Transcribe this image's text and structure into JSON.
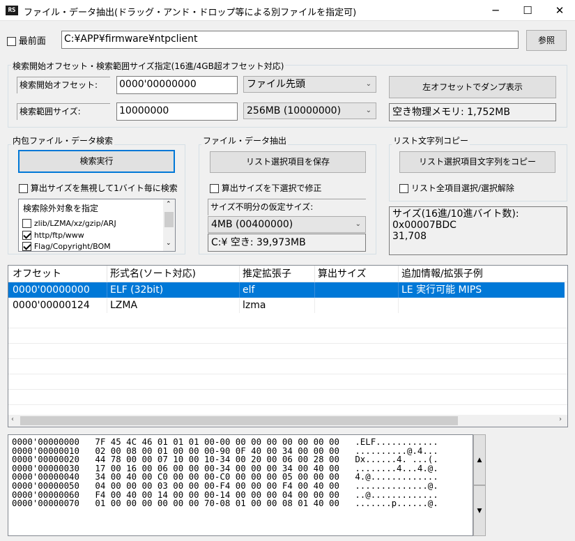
{
  "window": {
    "icon_text": "RS",
    "title": "ファイル・データ抽出(ドラッグ・アンド・ドロップ等による別ファイルを指定可)",
    "controls": [
      "─",
      "☐",
      "✕"
    ]
  },
  "topbar": {
    "topmost_label": "最前面",
    "path_value": "C:¥APP¥firmware¥ntpclient",
    "browse_label": "参照"
  },
  "search_range": {
    "group_title": "検索開始オフセット・検索範囲サイズ指定(16進/4GB超オフセット対応)",
    "start_offset_label": "検索開始オフセット:",
    "start_offset_value": "0000'00000000",
    "start_combo": "ファイル先頭",
    "range_size_label": "検索範囲サイズ:",
    "range_size_value": "10000000",
    "range_combo": "256MB (10000000)",
    "dump_button": "左オフセットでダンプ表示",
    "free_memory": "空き物理メモリ: 1,752MB"
  },
  "embedded_search": {
    "group_title": "内包ファイル・データ検索",
    "run_button": "検索実行",
    "ignore_size_label": "算出サイズを無視して1バイト毎に検索",
    "exclude_title": "検索除外対象を指定",
    "exclude_items": [
      {
        "label": "zlib/LZMA/xz/gzip/ARJ",
        "checked": false
      },
      {
        "label": "http/ftp/www",
        "checked": true
      },
      {
        "label": "Flag/Copyright/BOM",
        "checked": true
      }
    ]
  },
  "extract": {
    "group_title": "ファイル・データ抽出",
    "save_button": "リスト選択項目を保存",
    "fix_size_label": "算出サイズを下選択で修正",
    "unknown_size_label": "サイズ不明分の仮定サイズ:",
    "size_combo": "4MB   (00400000)",
    "drive_free": "C:¥  空き: 39,973MB"
  },
  "copy": {
    "group_title": "リスト文字列コピー",
    "copy_button": "リスト選択項目文字列をコピー",
    "select_all_label": "リスト全項目選択/選択解除",
    "size_info_lines": [
      "サイズ(16進/10進バイト数):",
      "0x00007BDC",
      "31,708"
    ]
  },
  "results": {
    "columns": [
      "オフセット",
      "形式名(ソート対応)",
      "推定拡張子",
      "算出サイズ",
      "追加情報/拡張子例"
    ],
    "rows": [
      {
        "offset": "0000'00000000",
        "format": "ELF (32bit)",
        "ext": "elf",
        "size": "",
        "info": "LE 実行可能 MIPS",
        "selected": true
      },
      {
        "offset": "0000'00000124",
        "format": "LZMA",
        "ext": "lzma",
        "size": "",
        "info": "",
        "selected": false
      }
    ]
  },
  "hexdump": {
    "lines": [
      "0000'00000000   7F 45 4C 46 01 01 01 00-00 00 00 00 00 00 00 00   .ELF............",
      "0000'00000010   02 00 08 00 01 00 00 00-90 0F 40 00 34 00 00 00   ..........@.4...",
      "0000'00000020   44 78 00 00 07 10 00 10-34 00 20 00 06 00 28 00   Dx......4. ...(.",
      "0000'00000030   17 00 16 00 06 00 00 00-34 00 00 00 34 00 40 00   ........4...4.@.",
      "0000'00000040   34 00 40 00 C0 00 00 00-C0 00 00 00 05 00 00 00   4.@.............",
      "0000'00000050   04 00 00 00 03 00 00 00-F4 00 00 00 F4 00 40 00   ..............@.",
      "0000'00000060   F4 00 40 00 14 00 00 00-14 00 00 00 04 00 00 00   ..@.............",
      "0000'00000070   01 00 00 00 00 00 00 70-08 01 00 00 08 01 40 00   .......p......@."
    ]
  },
  "colors": {
    "accent": "#0078d7",
    "window_bg": "#f0f0f0",
    "button_bg": "#e1e1e1"
  }
}
